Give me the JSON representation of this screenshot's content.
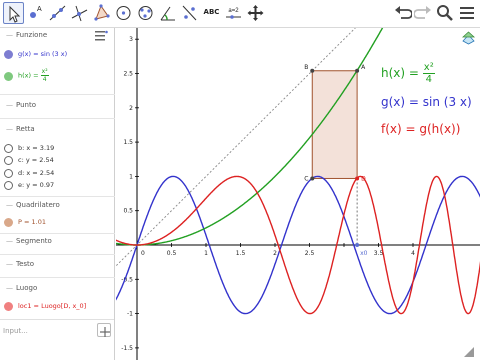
{
  "toolbar": {
    "tools": [
      {
        "name": "move-tool-icon",
        "selected": true
      },
      {
        "name": "point-tool-icon",
        "label": "A"
      },
      {
        "name": "line-tool-icon"
      },
      {
        "name": "perpendicular-line-tool-icon"
      },
      {
        "name": "polygon-tool-icon"
      },
      {
        "name": "circle-tool-icon"
      },
      {
        "name": "conic-tool-icon"
      },
      {
        "name": "angle-tool-icon"
      },
      {
        "name": "reflect-tool-icon"
      },
      {
        "name": "text-tool",
        "label": "ABC"
      },
      {
        "name": "slider-tool",
        "label": "a=2"
      },
      {
        "name": "move-graphics-tool-icon"
      }
    ],
    "right_buttons": [
      "undo-icon",
      "redo-icon",
      "search-icon",
      "menu-icon"
    ]
  },
  "algebra": {
    "categories": [
      {
        "label": "Funzione",
        "items": [
          {
            "text": "g(x) = sin (3 x)",
            "color": "#7d7dd1",
            "text_color": "#3333cc",
            "filled": true
          },
          {
            "text_main": "h(x) =",
            "frac_num": "x²",
            "frac_den": "4",
            "color": "#7fc97f",
            "text_color": "#22a022",
            "filled": true
          }
        ]
      },
      {
        "label": "Punto",
        "items": []
      },
      {
        "label": "Retta",
        "items": [
          {
            "text": "b: x = 3.19",
            "filled": false
          },
          {
            "text": "c: y = 2.54",
            "filled": false
          },
          {
            "text": "d: x = 2.54",
            "filled": false
          },
          {
            "text": "e: y = 0.97",
            "filled": false
          }
        ]
      },
      {
        "label": "Quadrilatero",
        "items": [
          {
            "text": "P = 1.01",
            "color": "#d9a88a",
            "text_color": "#a0522d",
            "filled": true
          }
        ]
      },
      {
        "label": "Segmento",
        "items": []
      },
      {
        "label": "Testo",
        "items": []
      },
      {
        "label": "Luogo",
        "items": [
          {
            "text": "loc1 = Luogo[D, x_0]",
            "color": "#f08080",
            "text_color": "#dd2222",
            "filled": true
          }
        ]
      }
    ],
    "input_placeholder": "Input..."
  },
  "graphics": {
    "equations": {
      "h_prefix": "h(x) =",
      "h_num": "x²",
      "h_den": "4",
      "g": "g(x) = sin (3 x)",
      "f": "f(x) = g(h(x))"
    },
    "point_labels": [
      "A",
      "B",
      "C",
      "D"
    ],
    "x0_label": "x0",
    "x_ticks": [
      "0.5",
      "1",
      "1.5",
      "2",
      "2.5",
      "3",
      "3.5",
      "4"
    ],
    "y_ticks": [
      "3",
      "2.5",
      "2",
      "1.5",
      "1",
      "0.5",
      "-0.5",
      "-1",
      "-1.5"
    ],
    "colors": {
      "g": "#3333cc",
      "h": "#22a022",
      "f": "#dd2222",
      "quad_fill": "#f3e1d9",
      "quad_stroke": "#a0522d",
      "axis": "#000000",
      "diagonal": "#888888"
    }
  }
}
